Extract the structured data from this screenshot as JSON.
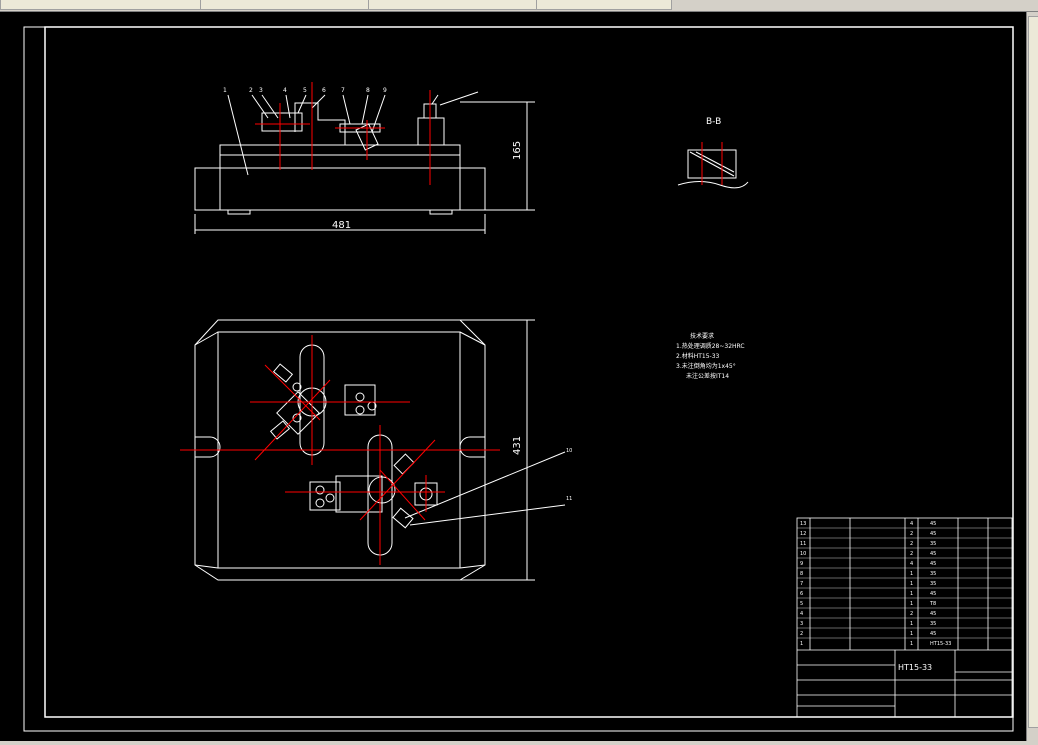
{
  "tabs": [
    {
      "label": ""
    },
    {
      "label": ""
    },
    {
      "label": ""
    },
    {
      "label": ""
    }
  ],
  "drawing": {
    "section_label": "B-B",
    "dim_height": "165",
    "dim_width_front": "481",
    "dim_height_plan": "431",
    "notes_title": "技术要求",
    "note_lines": [
      "1.热处理调质28~32HRC",
      "2.材料HT15-33",
      "3.未注倒角均为1x45°",
      "未注公差按IT14"
    ],
    "part_numbers_top": [
      "1",
      "2",
      "3",
      "4",
      "5",
      "6",
      "7",
      "8",
      "9"
    ],
    "leader_labels": [
      "10",
      "11"
    ],
    "titleblock": {
      "material": "HT15-33",
      "rows": [
        {
          "no": "13",
          "name": "",
          "qty": "4",
          "mat": "45"
        },
        {
          "no": "12",
          "name": "",
          "qty": "2",
          "mat": "45"
        },
        {
          "no": "11",
          "name": "",
          "qty": "2",
          "mat": "35"
        },
        {
          "no": "10",
          "name": "",
          "qty": "2",
          "mat": "45"
        },
        {
          "no": "9",
          "name": "",
          "qty": "4",
          "mat": "45"
        },
        {
          "no": "8",
          "name": "",
          "qty": "1",
          "mat": "35"
        },
        {
          "no": "7",
          "name": "",
          "qty": "1",
          "mat": "35"
        },
        {
          "no": "6",
          "name": "",
          "qty": "1",
          "mat": "45"
        },
        {
          "no": "5",
          "name": "",
          "qty": "1",
          "mat": "T8"
        },
        {
          "no": "4",
          "name": "",
          "qty": "2",
          "mat": "45"
        },
        {
          "no": "3",
          "name": "",
          "qty": "1",
          "mat": "35"
        },
        {
          "no": "2",
          "name": "",
          "qty": "1",
          "mat": "45"
        },
        {
          "no": "1",
          "name": "",
          "qty": "1",
          "mat": "HT15-33"
        }
      ]
    }
  },
  "colors": {
    "line": "#ffffff",
    "center": "#ff0000",
    "bg": "#000000",
    "accent": "#ffff00"
  }
}
